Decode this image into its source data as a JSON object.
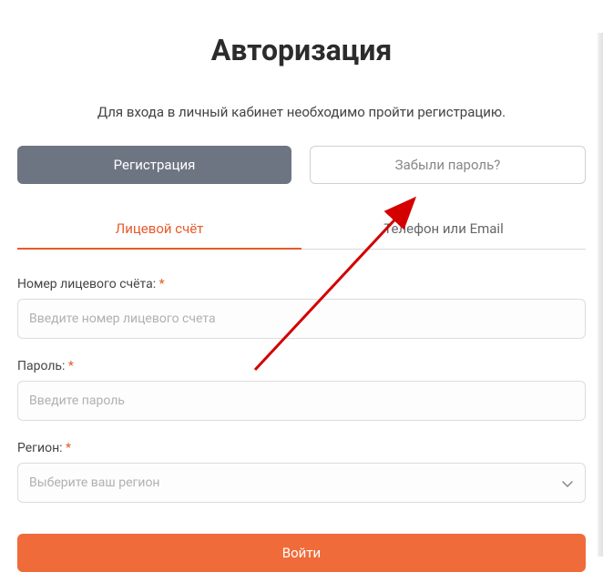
{
  "header": {
    "title": "Авторизация",
    "description": "Для входа в личный кабинет необходимо пройти регистрацию."
  },
  "buttons": {
    "register": "Регистрация",
    "forgot_password": "Забыли пароль?",
    "submit": "Войти"
  },
  "tabs": {
    "account": "Лицевой счёт",
    "phone_email": "Телефон или Email"
  },
  "form": {
    "account_number": {
      "label": "Номер лицевого счёта: ",
      "placeholder": "Введите номер лицевого счета"
    },
    "password": {
      "label": "Пароль: ",
      "placeholder": "Введите пароль"
    },
    "region": {
      "label": "Регион: ",
      "placeholder": "Выберите ваш регион"
    },
    "required_marker": "*"
  },
  "colors": {
    "accent": "#e85a2b",
    "submit": "#ef6b3a",
    "register_bg": "#6e7582"
  }
}
